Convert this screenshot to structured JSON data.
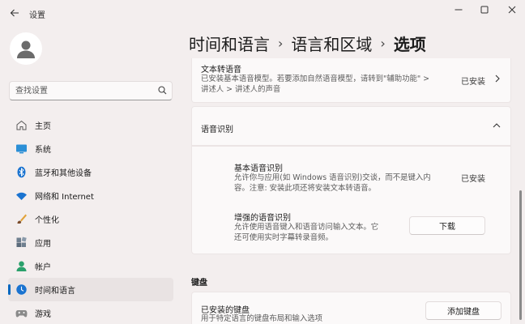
{
  "window": {
    "title": "设置"
  },
  "profile": {},
  "search": {
    "placeholder": "查找设置"
  },
  "nav": {
    "items": [
      {
        "label": "主页",
        "icon": "home-icon"
      },
      {
        "label": "系统",
        "icon": "monitor-icon"
      },
      {
        "label": "蓝牙和其他设备",
        "icon": "bluetooth-icon"
      },
      {
        "label": "网络和 Internet",
        "icon": "wifi-icon"
      },
      {
        "label": "个性化",
        "icon": "brush-icon"
      },
      {
        "label": "应用",
        "icon": "apps-icon"
      },
      {
        "label": "帐户",
        "icon": "person-icon"
      },
      {
        "label": "时间和语言",
        "icon": "clock-globe-icon",
        "active": true
      },
      {
        "label": "游戏",
        "icon": "gamepad-icon"
      }
    ]
  },
  "breadcrumb": {
    "part1": "时间和语言",
    "part2": "语言和区域",
    "current": "选项",
    "separator": "›"
  },
  "tts": {
    "title": "文本转语音",
    "desc_line1": "已安装基本语音模型。若要添加自然语音模型，请转到\"辅助功能\" >",
    "desc_line2": "讲述人 > 讲述人的声音",
    "status": "已安装"
  },
  "speech_recognition": {
    "title": "语音识别",
    "basic": {
      "title": "基本语音识别",
      "desc_line1": "允许你与应用(如 Windows 语音识别)交谈，而不是键入内",
      "desc_line2": "容。注意: 安装此项还将安装文本转语音。",
      "status": "已安装"
    },
    "enhanced": {
      "title": "增强的语音识别",
      "desc_line1": "允许使用语音键入和语音访问输入文本。它",
      "desc_line2": "还可使用实时字幕转录音频。",
      "button": "下载"
    }
  },
  "keyboard": {
    "section": "键盘",
    "installed_title": "已安装的键盘",
    "installed_desc": "用于特定语言的键盘布局和输入选项",
    "add_button": "添加键盘"
  },
  "colors": {
    "accent": "#0067c0",
    "background": "#f3eeee",
    "card": "#fbf9f9"
  }
}
